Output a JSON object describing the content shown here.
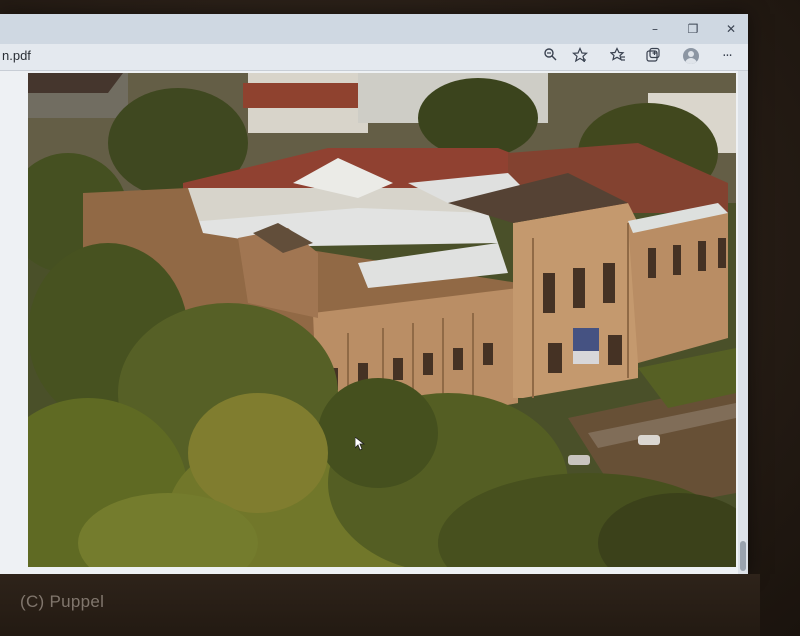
{
  "window": {
    "controls": {
      "minimize": "–",
      "restore": "❐",
      "close": "✕"
    }
  },
  "toolbar": {
    "filename": "n.pdf",
    "icons": [
      "zoom-icon",
      "favorite-add-icon",
      "favorites-icon",
      "collections-icon",
      "profile-avatar",
      "more-icon"
    ],
    "more_label": "···"
  },
  "document": {
    "image_subject": "aerial-photo-museum-building"
  },
  "watermark": {
    "text": "(C) Puppel"
  },
  "colors": {
    "titlebar": "#cfd8e2",
    "toolbar": "#e4e9ef",
    "viewer": "#eef1f4",
    "wall": "#2b2118",
    "sandstone": "#b98e66",
    "roof_white": "#e6ecef",
    "tree_green": "#4a5a22"
  }
}
